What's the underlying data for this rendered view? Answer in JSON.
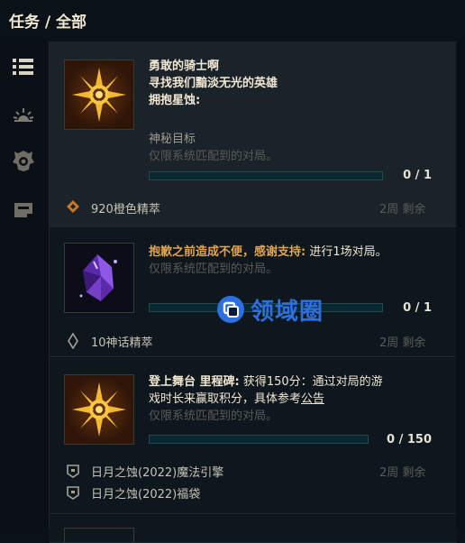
{
  "header": {
    "title": "任务 / 全部"
  },
  "sidebar": {
    "items": [
      {
        "icon": "list-icon",
        "active": true
      },
      {
        "icon": "sunrise-icon",
        "active": false
      },
      {
        "icon": "emblem-icon",
        "active": false
      },
      {
        "icon": "store-icon",
        "active": false
      }
    ]
  },
  "quests": [
    {
      "title_lines": [
        "勇敢的骑士啊",
        "寻找我们黯淡无光的英雄",
        "拥抱星蚀:"
      ],
      "objective": "神秘目标",
      "condition": "仅限系统匹配到的对局。",
      "progress_text": "0 / 1",
      "progress": 0,
      "reward": "920橙色精萃",
      "remaining": "2周 剩余"
    },
    {
      "title": "抱歉之前造成不便，感谢支持:",
      "desc": " 进行1场对局。",
      "condition": "仅限系统匹配到的对局。",
      "progress_text": "0 / 1",
      "progress": 0,
      "reward": "10神话精萃",
      "remaining": "2周 剩余"
    },
    {
      "title": "登上舞台 里程碑:",
      "desc_line1": " 获得150分：通过对局的游",
      "desc_line2": "戏时长来赢取积分，具体参考",
      "link": "公告",
      "condition": "仅限系统匹配到的对局。",
      "progress_text": "0 / 150",
      "progress": 0,
      "rewards": [
        "日月之蚀(2022)魔法引擎",
        "日月之蚀(2022)福袋"
      ],
      "remaining": "2周 剩余"
    }
  ],
  "watermark": {
    "text": "领域圈",
    "icon": "logo-icon"
  },
  "colors": {
    "accent": "#e0a450",
    "gold_text": "#f0e6d2",
    "bar": "#0a2830",
    "watermark": "#2e6fe0"
  }
}
